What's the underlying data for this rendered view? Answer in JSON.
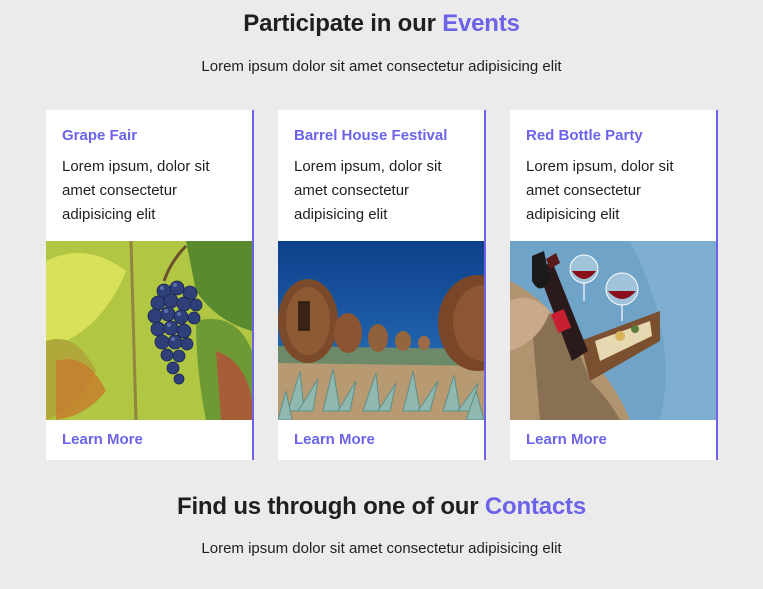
{
  "events": {
    "title_prefix": "Participate in our ",
    "title_accent": "Events",
    "subtitle": "Lorem ipsum dolor sit amet consectetur adipisicing elit"
  },
  "cards": [
    {
      "title": "Grape Fair",
      "text": "Lorem ipsum, dolor sit amet consectetur adipisicing elit",
      "image": "grapes-photo",
      "link": "Learn More"
    },
    {
      "title": "Barrel House Festival",
      "text": "Lorem ipsum, dolor sit amet consectetur adipisicing elit",
      "image": "barrel-houses-photo",
      "link": "Learn More"
    },
    {
      "title": "Red Bottle Party",
      "text": "Lorem ipsum, dolor sit amet consectetur adipisicing elit",
      "image": "wine-picnic-photo",
      "link": "Learn More"
    }
  ],
  "contacts": {
    "title_prefix": "Find us through one of our ",
    "title_accent": "Contacts",
    "subtitle": "Lorem ipsum dolor sit amet consectetur adipisicing elit"
  },
  "colors": {
    "accent": "#6c63ea",
    "background": "#ebebeb",
    "card": "#ffffff"
  }
}
